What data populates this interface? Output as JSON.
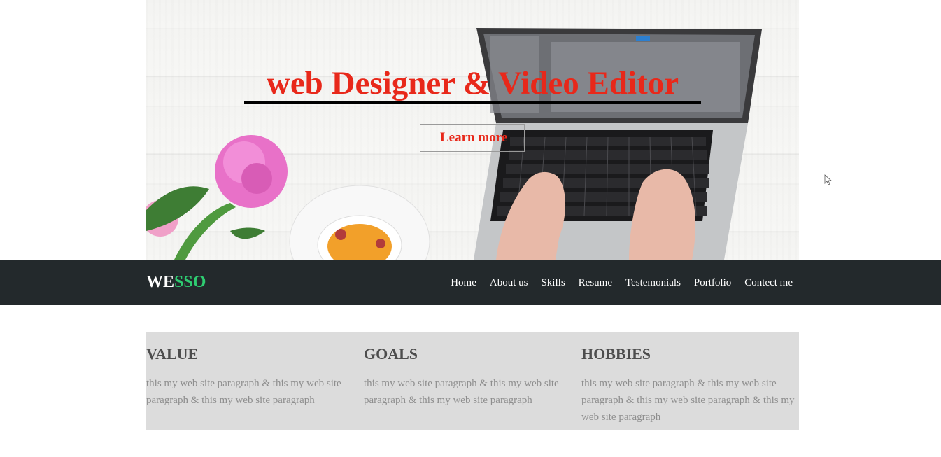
{
  "hero": {
    "title": "web Designer & Video Editor",
    "button_label": "Learn more"
  },
  "navbar": {
    "logo_part1": "WE",
    "logo_part2": "SSO",
    "items": [
      {
        "label": "Home"
      },
      {
        "label": "About us"
      },
      {
        "label": "Skills"
      },
      {
        "label": "Resume"
      },
      {
        "label": "Testemonials"
      },
      {
        "label": "Portfolio"
      },
      {
        "label": "Contect me"
      }
    ]
  },
  "features": [
    {
      "title": "VALUE",
      "text": "this my web site paragraph & this my web site paragraph & this my web site paragraph"
    },
    {
      "title": "GOALS",
      "text": "this my web site paragraph & this my web site paragraph & this my web site paragraph"
    },
    {
      "title": "HOBBIES",
      "text": "this my web site paragraph & this my web site paragraph & this my web site paragraph & this my web site paragraph"
    }
  ],
  "colors": {
    "accent_red": "#e8281a",
    "logo_green": "#2ecc71",
    "navbar_bg": "#23292c",
    "features_bg": "#dcdcdc"
  },
  "icons": {
    "cursor": "mouse-pointer-icon"
  }
}
